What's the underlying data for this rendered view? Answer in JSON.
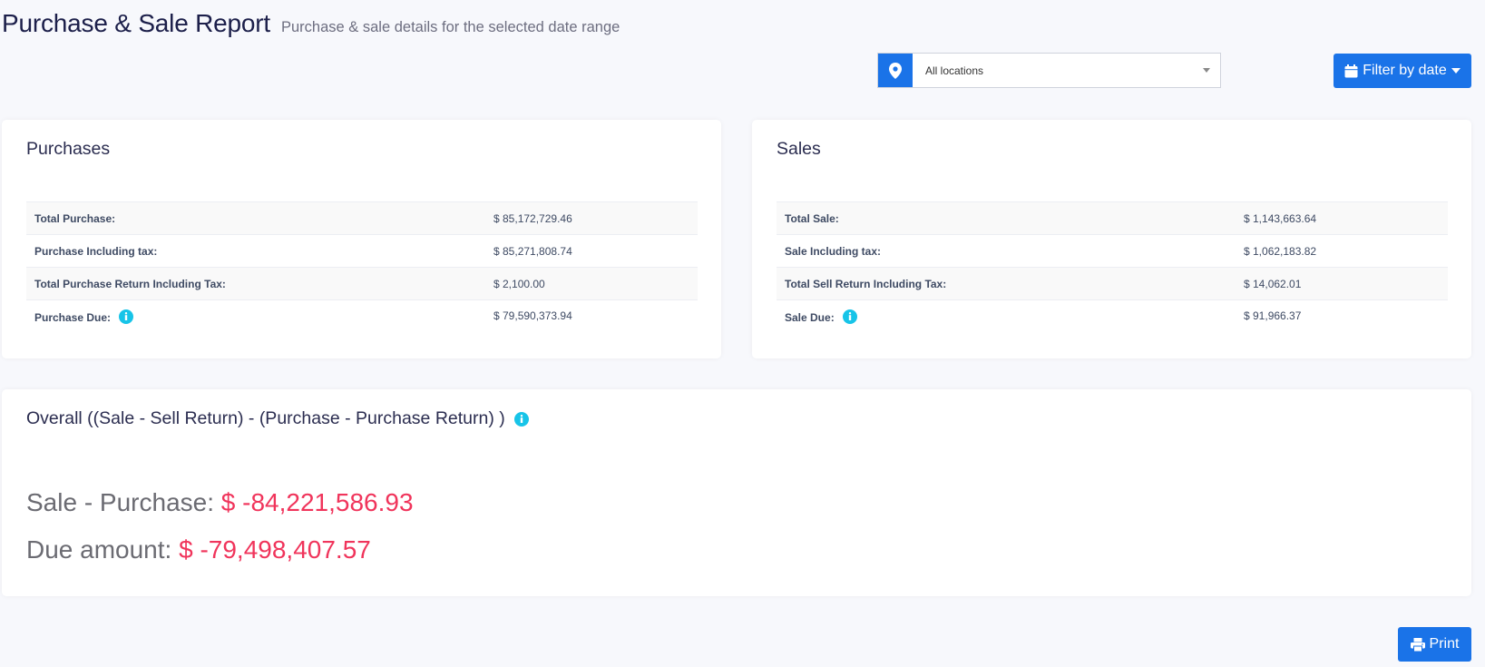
{
  "header": {
    "title": "Purchase & Sale Report",
    "subtitle": "Purchase & sale details for the selected date range"
  },
  "filters": {
    "location_icon": "map-marker-icon",
    "location_value": "All locations",
    "filter_by_date_label": "Filter by date",
    "filter_icon": "calendar-icon"
  },
  "purchases": {
    "title": "Purchases",
    "rows": [
      {
        "label": "Total Purchase:",
        "value": "$ 85,172,729.46"
      },
      {
        "label": "Purchase Including tax:",
        "value": "$ 85,271,808.74"
      },
      {
        "label": "Total Purchase Return Including Tax:",
        "value": "$ 2,100.00"
      },
      {
        "label": "Purchase Due:",
        "value": "$ 79,590,373.94"
      }
    ]
  },
  "sales": {
    "title": "Sales",
    "rows": [
      {
        "label": "Total Sale:",
        "value": "$ 1,143,663.64"
      },
      {
        "label": "Sale Including tax:",
        "value": "$ 1,062,183.82"
      },
      {
        "label": "Total Sell Return Including Tax:",
        "value": "$ 14,062.01"
      },
      {
        "label": "Sale Due:",
        "value": "$ 91,966.37"
      }
    ]
  },
  "overall": {
    "title": "Overall ((Sale - Sell Return) - (Purchase - Purchase Return) )",
    "sale_minus_purchase_label": "Sale - Purchase:",
    "sale_minus_purchase_value": "$ -84,221,586.93",
    "due_amount_label": "Due amount:",
    "due_amount_value": "$ -79,498,407.57"
  },
  "actions": {
    "print_label": "Print",
    "print_icon": "printer-icon"
  },
  "colors": {
    "primary": "#1a73e8",
    "info": "#17c4e8",
    "negative_amount": "#f0345b",
    "background": "#f7f8fc"
  }
}
